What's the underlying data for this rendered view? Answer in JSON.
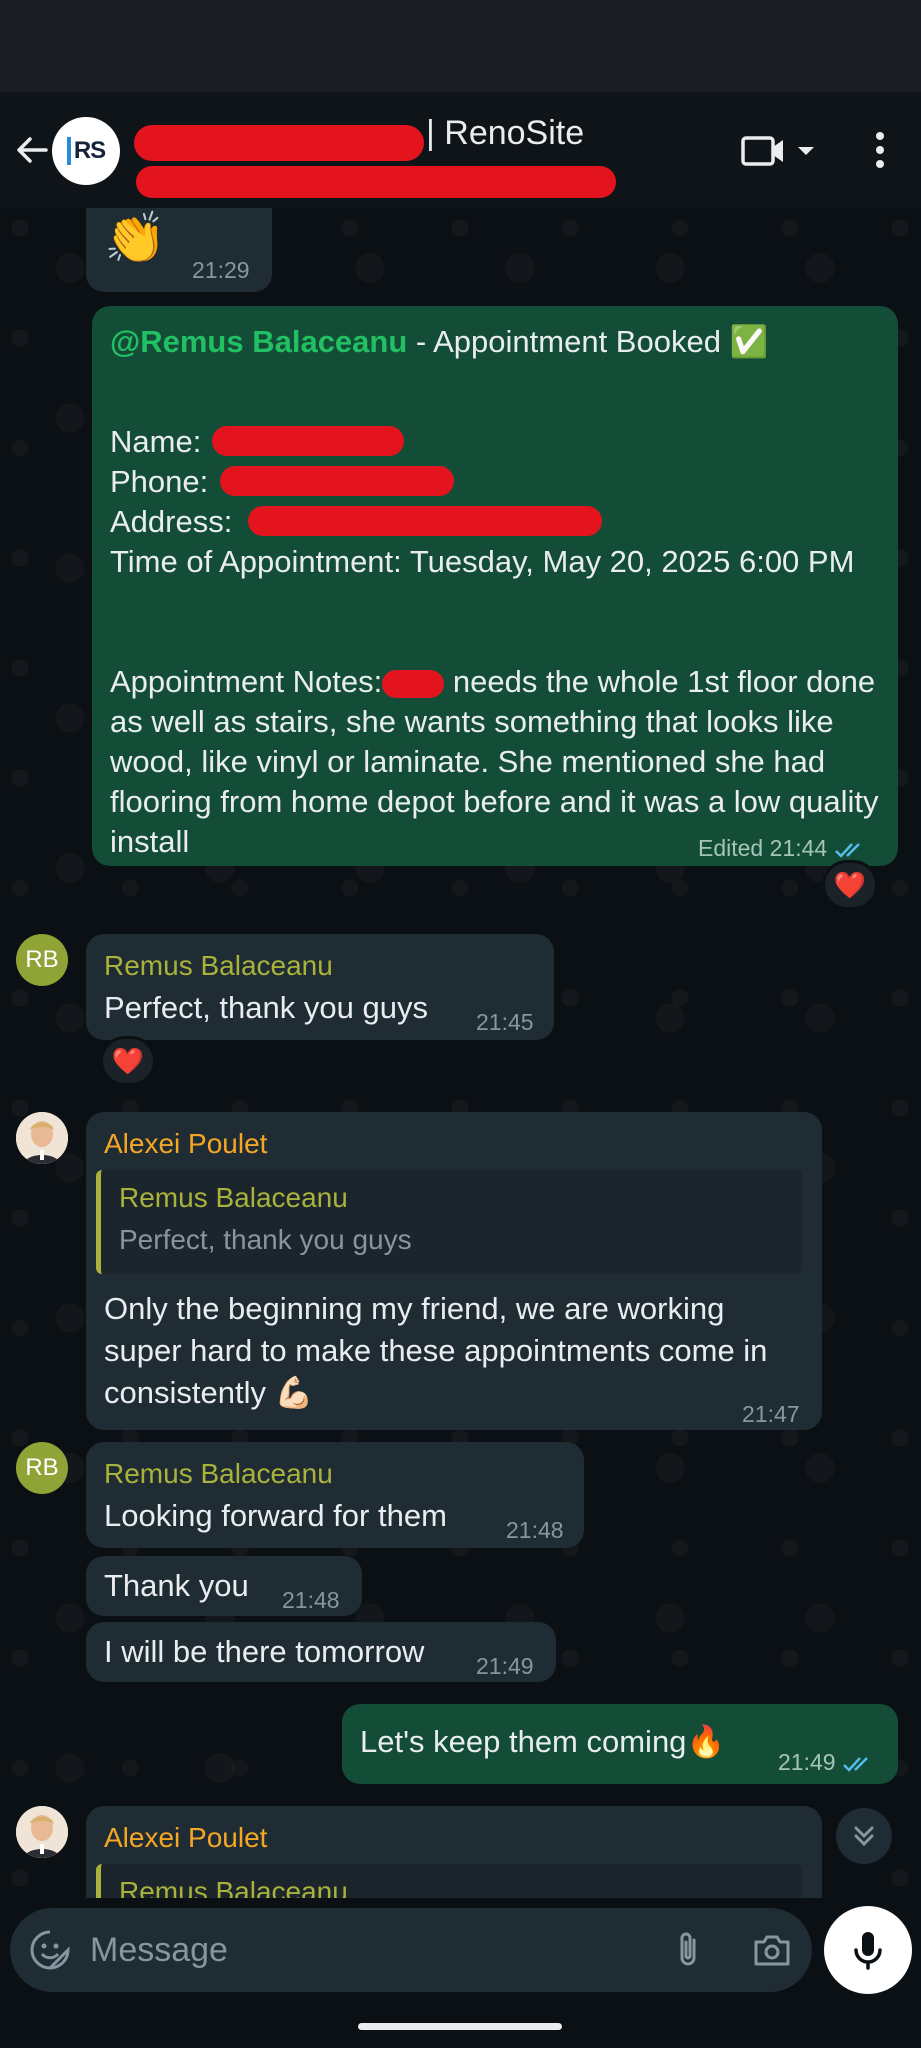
{
  "header": {
    "title": "| RenoSite",
    "logo_text": "RS"
  },
  "messages": {
    "m1": {
      "time": "21:29",
      "emoji": "👏"
    },
    "m2": {
      "mention": "@Remus Balaceanu",
      "title_rest": " - Appointment Booked ",
      "check": "✅",
      "name_label": "Name:",
      "phone_label": "Phone:",
      "address_label": "Address:",
      "time_line": "Time of Appointment: Tuesday, May 20, 2025 6:00 PM",
      "notes_label": "Appointment Notes:",
      "notes_body": " needs the whole 1st floor done as well as stairs, she wants something that looks like wood, like vinyl or laminate. She mentioned she had flooring from home depot before and it was a low quality install",
      "status": "Edited 21:44",
      "reaction": "❤️"
    },
    "m3": {
      "avatar": "RB",
      "sender": "Remus Balaceanu",
      "text": "Perfect, thank you guys",
      "time": "21:45",
      "reaction": "❤️"
    },
    "m4": {
      "sender": "Alexei Poulet",
      "quote_sender": "Remus Balaceanu",
      "quote_text": "Perfect, thank you guys",
      "text": "Only the beginning my friend, we are working super hard to make these appointments come in consistently ",
      "emoji": "💪🏻",
      "time": "21:47"
    },
    "m5": {
      "avatar": "RB",
      "sender": "Remus Balaceanu",
      "text": "Looking forward for them",
      "time": "21:48"
    },
    "m6": {
      "text": "Thank you",
      "time": "21:48"
    },
    "m7": {
      "text": "I will be there tomorrow",
      "time": "21:49"
    },
    "m8": {
      "text": "Let's keep them coming",
      "emoji": "🔥",
      "time": "21:49"
    },
    "m9": {
      "sender": "Alexei Poulet",
      "quote_sender": "Remus Balaceanu"
    }
  },
  "composer": {
    "placeholder": "Message"
  },
  "colors": {
    "accent_green": "#21c063",
    "sender_remus": "#a9b23a",
    "sender_alexei": "#f5a623",
    "outgoing": "#144d37",
    "incoming": "#202c33"
  }
}
